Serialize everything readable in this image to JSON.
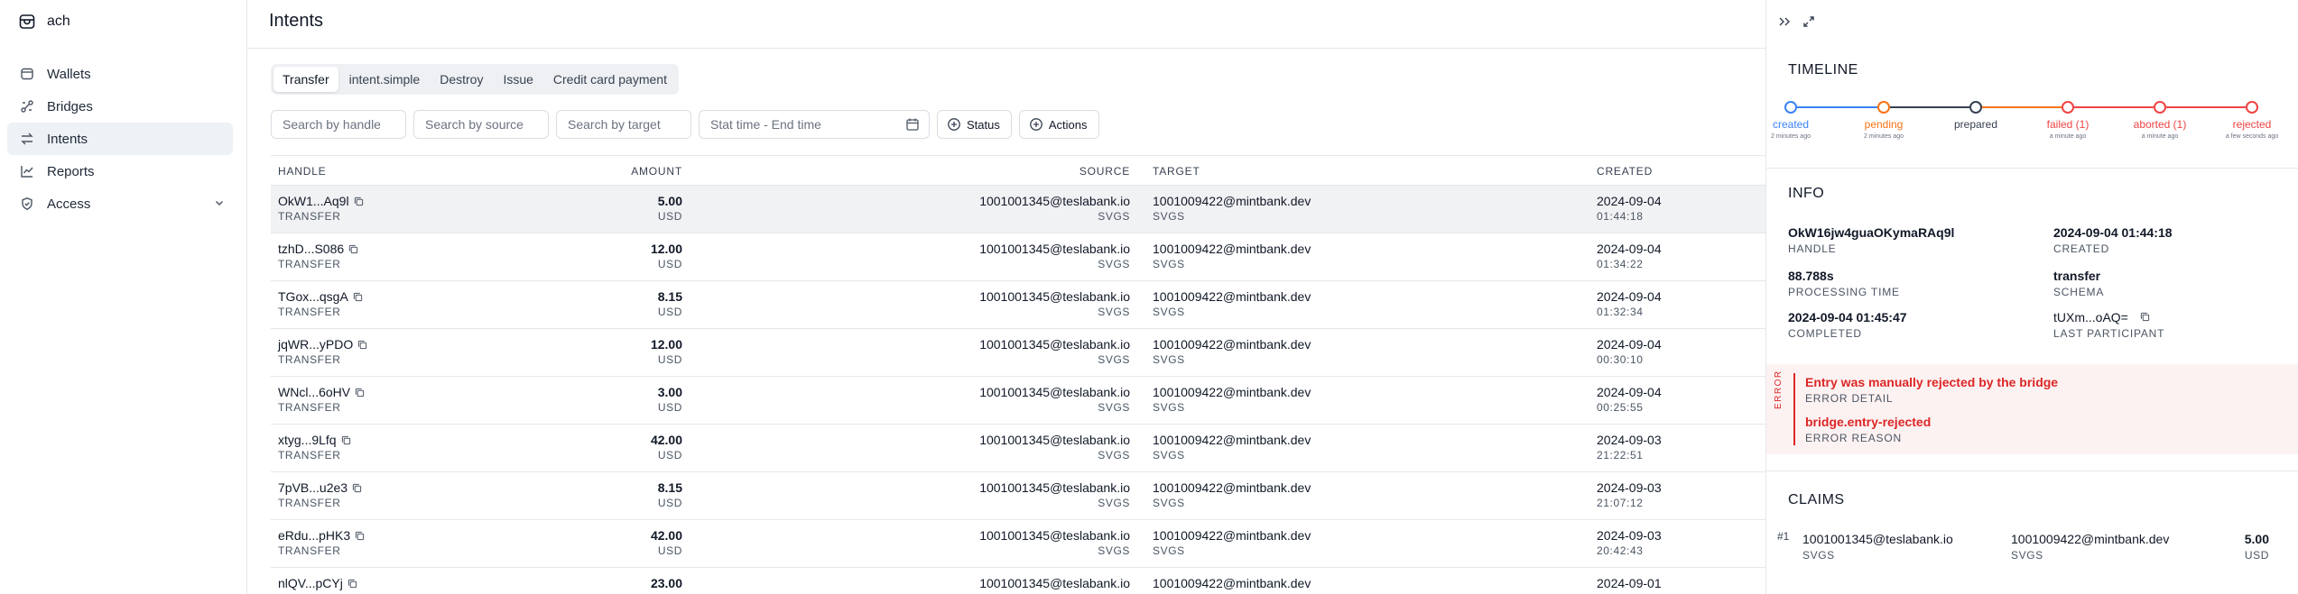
{
  "app": {
    "name": "ach"
  },
  "sidebar": {
    "items": [
      {
        "label": "Wallets",
        "icon": "wallet-icon"
      },
      {
        "label": "Bridges",
        "icon": "bridge-icon"
      },
      {
        "label": "Intents",
        "icon": "arrows-icon",
        "active": true
      },
      {
        "label": "Reports",
        "icon": "chart-icon"
      },
      {
        "label": "Access",
        "icon": "shield-icon",
        "expandable": true
      }
    ]
  },
  "page": {
    "title": "Intents"
  },
  "tabs": [
    {
      "label": "Transfer",
      "active": true
    },
    {
      "label": "intent.simple"
    },
    {
      "label": "Destroy"
    },
    {
      "label": "Issue"
    },
    {
      "label": "Credit card payment"
    }
  ],
  "filters": {
    "handle_placeholder": "Search by handle",
    "source_placeholder": "Search by source",
    "target_placeholder": "Search by target",
    "date_placeholder": "Stat time - End time",
    "status_label": "Status",
    "actions_label": "Actions"
  },
  "table": {
    "headers": {
      "handle": "HANDLE",
      "amount": "AMOUNT",
      "source": "SOURCE",
      "target": "TARGET",
      "created": "CREATED"
    },
    "rows": [
      {
        "handle": "OkW1...Aq9l",
        "type": "TRANSFER",
        "amount": "5.00",
        "currency": "USD",
        "source": "1001001345@teslabank.io",
        "source_sub": "SVGS",
        "target": "1001009422@mintbank.dev",
        "target_sub": "SVGS",
        "date": "2024-09-04",
        "time": "01:44:18"
      },
      {
        "handle": "tzhD...S086",
        "type": "TRANSFER",
        "amount": "12.00",
        "currency": "USD",
        "source": "1001001345@teslabank.io",
        "source_sub": "SVGS",
        "target": "1001009422@mintbank.dev",
        "target_sub": "SVGS",
        "date": "2024-09-04",
        "time": "01:34:22"
      },
      {
        "handle": "TGox...qsgA",
        "type": "TRANSFER",
        "amount": "8.15",
        "currency": "USD",
        "source": "1001001345@teslabank.io",
        "source_sub": "SVGS",
        "target": "1001009422@mintbank.dev",
        "target_sub": "SVGS",
        "date": "2024-09-04",
        "time": "01:32:34"
      },
      {
        "handle": "jqWR...yPDO",
        "type": "TRANSFER",
        "amount": "12.00",
        "currency": "USD",
        "source": "1001001345@teslabank.io",
        "source_sub": "SVGS",
        "target": "1001009422@mintbank.dev",
        "target_sub": "SVGS",
        "date": "2024-09-04",
        "time": "00:30:10"
      },
      {
        "handle": "WNcl...6oHV",
        "type": "TRANSFER",
        "amount": "3.00",
        "currency": "USD",
        "source": "1001001345@teslabank.io",
        "source_sub": "SVGS",
        "target": "1001009422@mintbank.dev",
        "target_sub": "SVGS",
        "date": "2024-09-04",
        "time": "00:25:55"
      },
      {
        "handle": "xtyg...9Lfq",
        "type": "TRANSFER",
        "amount": "42.00",
        "currency": "USD",
        "source": "1001001345@teslabank.io",
        "source_sub": "SVGS",
        "target": "1001009422@mintbank.dev",
        "target_sub": "SVGS",
        "date": "2024-09-03",
        "time": "21:22:51"
      },
      {
        "handle": "7pVB...u2e3",
        "type": "TRANSFER",
        "amount": "8.15",
        "currency": "USD",
        "source": "1001001345@teslabank.io",
        "source_sub": "SVGS",
        "target": "1001009422@mintbank.dev",
        "target_sub": "SVGS",
        "date": "2024-09-03",
        "time": "21:07:12"
      },
      {
        "handle": "eRdu...pHK3",
        "type": "TRANSFER",
        "amount": "42.00",
        "currency": "USD",
        "source": "1001001345@teslabank.io",
        "source_sub": "SVGS",
        "target": "1001009422@mintbank.dev",
        "target_sub": "SVGS",
        "date": "2024-09-03",
        "time": "20:42:43"
      },
      {
        "handle": "nlQV...pCYj",
        "type": "TRANSFER",
        "amount": "23.00",
        "currency": "USD",
        "source": "1001001345@teslabank.io",
        "source_sub": "SVGS",
        "target": "1001009422@mintbank.dev",
        "target_sub": "SVGS",
        "date": "2024-09-01",
        "time": ""
      }
    ]
  },
  "panel": {
    "timeline_title": "TIMELINE",
    "timeline": [
      {
        "label": "created",
        "sub": "2 minutes ago",
        "color": "#3b82f6"
      },
      {
        "label": "pending",
        "sub": "2 minutes ago",
        "color": "#f97316"
      },
      {
        "label": "prepared",
        "sub": "",
        "color": "#374151"
      },
      {
        "label": "failed (1)",
        "sub": "a minute ago",
        "color": "#ef4444"
      },
      {
        "label": "aborted (1)",
        "sub": "a minute ago",
        "color": "#ef4444"
      },
      {
        "label": "rejected",
        "sub": "a few seconds ago",
        "color": "#ef4444"
      }
    ],
    "info_title": "INFO",
    "info": [
      {
        "value": "OkW16jw4guaOKymaRAq9l",
        "key": "HANDLE"
      },
      {
        "value": "2024-09-04 01:44:18",
        "key": "CREATED"
      },
      {
        "value": "88.788s",
        "key": "PROCESSING TIME"
      },
      {
        "value": "transfer",
        "key": "SCHEMA"
      },
      {
        "value": "2024-09-04 01:45:47",
        "key": "COMPLETED"
      },
      {
        "value": "tUXm...oAQ=",
        "key": "LAST PARTICIPANT"
      }
    ],
    "error": {
      "label": "ERROR",
      "detail": "Entry was manually rejected by the bridge",
      "detail_key": "ERROR DETAIL",
      "reason": "bridge.entry-rejected",
      "reason_key": "ERROR REASON"
    },
    "claims_title": "CLAIMS",
    "claims": [
      {
        "index": "#1",
        "source": "1001001345@teslabank.io",
        "source_sub": "SVGS",
        "target": "1001009422@mintbank.dev",
        "target_sub": "SVGS",
        "amount": "5.00",
        "currency": "USD"
      }
    ]
  },
  "colors": {
    "accent_red": "#dc2626",
    "selected_row": "#f1f2f4",
    "active_nav": "#eef1f5"
  }
}
